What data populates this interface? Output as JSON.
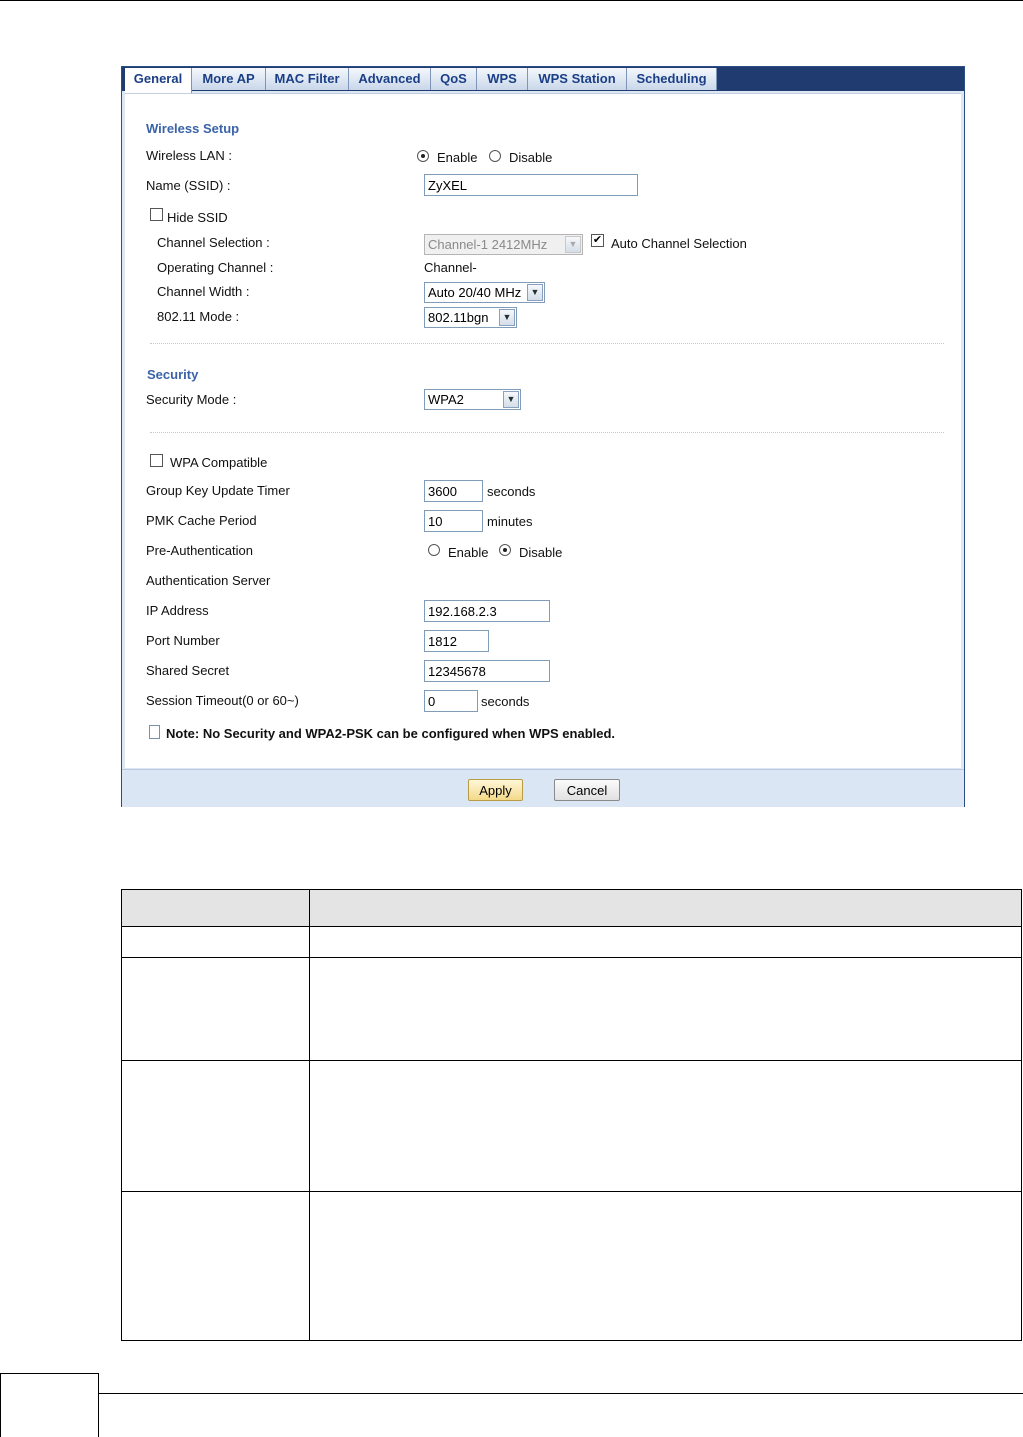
{
  "tabs": [
    "General",
    "More AP",
    "MAC Filter",
    "Advanced",
    "QoS",
    "WPS",
    "WPS Station",
    "Scheduling"
  ],
  "wireless_setup": {
    "section_title": "Wireless Setup",
    "wireless_lan_label": "Wireless LAN :",
    "enable_label": "Enable",
    "disable_label": "Disable",
    "wireless_lan_value": "Enable",
    "ssid_label": "Name (SSID) :",
    "ssid_value": "ZyXEL",
    "hide_ssid_label": "Hide SSID",
    "hide_ssid_checked": false,
    "channel_selection_label": "Channel Selection :",
    "channel_selection_value": "Channel-1 2412MHz",
    "auto_channel_label": "Auto Channel Selection",
    "auto_channel_checked": true,
    "operating_channel_label": "Operating Channel :",
    "operating_channel_value": "Channel-",
    "channel_width_label": "Channel Width :",
    "channel_width_value": "Auto 20/40 MHz",
    "mode_label": "802.11 Mode :",
    "mode_value": "802.11bgn"
  },
  "security": {
    "section_title": "Security",
    "security_mode_label": "Security Mode :",
    "security_mode_value": "WPA2",
    "wpa_compatible_label": "WPA Compatible",
    "wpa_compatible_checked": false,
    "group_key_label": "Group Key Update Timer",
    "group_key_value": "3600",
    "group_key_unit": "seconds",
    "pmk_label": "PMK Cache Period",
    "pmk_value": "10",
    "pmk_unit": "minutes",
    "preauth_label": "Pre-Authentication",
    "preauth_enable_label": "Enable",
    "preauth_disable_label": "Disable",
    "preauth_value": "Disable",
    "auth_server_label": "Authentication Server",
    "ip_label": "IP Address",
    "ip_value": "192.168.2.3",
    "port_label": "Port Number",
    "port_value": "1812",
    "secret_label": "Shared Secret",
    "secret_value": "12345678",
    "timeout_label": "Session Timeout(0 or 60~)",
    "timeout_value": "0",
    "timeout_unit": "seconds"
  },
  "note": "Note: No Security and WPA2-PSK can be configured when WPS enabled.",
  "buttons": {
    "apply": "Apply",
    "cancel": "Cancel"
  }
}
